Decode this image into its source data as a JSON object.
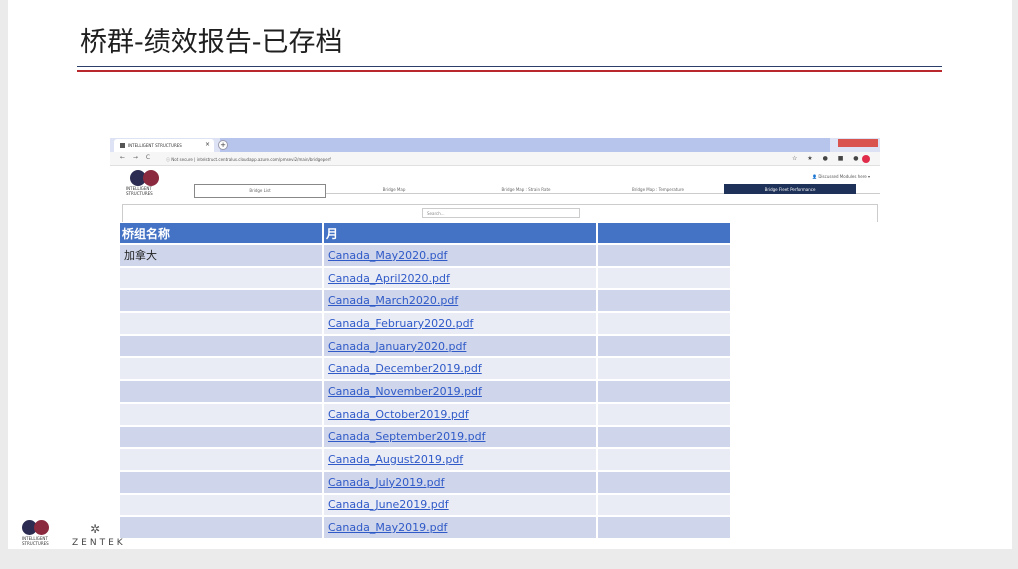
{
  "slide": {
    "title": "桥群-绩效报告-已存档"
  },
  "browser": {
    "tab_title": "INTELLIGENT STRUCTURES",
    "tab_close": "×",
    "new_tab": "+",
    "nav_buttons": "← → C",
    "url": "ⓘ Not secure  |  intelstruct.centralus.cloudapp.azure.com/pmsevi2/main/bridgeperf",
    "ext_icons": "☆ ★ ● ■ ●",
    "logo_text": "INTELLIGENT STRUCTURES",
    "signout": "👤 Discussed Modules here ▾",
    "nav_tabs": [
      "Bridge List",
      "Bridge Map",
      "Bridge Map : Strain Rate",
      "Bridge Map : Temperature",
      "Bridge Fleet Performance"
    ],
    "search_placeholder": "Search..."
  },
  "table": {
    "headers": [
      "桥组名称",
      "月",
      ""
    ],
    "group_name": "加拿大",
    "rows": [
      "Canada_May2020.pdf",
      "Canada_April2020.pdf",
      "Canada_March2020.pdf",
      "Canada_February2020.pdf",
      "Canada_January2020.pdf",
      "Canada_December2019.pdf",
      "Canada_November2019.pdf",
      "Canada_October2019.pdf",
      "Canada_September2019.pdf",
      "Canada_August2019.pdf",
      "Canada_July2019.pdf",
      "Canada_June2019.pdf",
      "Canada_May2019.pdf"
    ]
  },
  "footer": {
    "logo_text": "INTELLIGENT STRUCTURES",
    "zentek": "ZENTEK"
  },
  "colors": {
    "header_blue": "#4472c4",
    "row_dark": "#cfd5ea",
    "row_light": "#e9ebf5",
    "link": "#2f5ac8",
    "rule_navy": "#2c3e6b",
    "rule_red": "#b8282c"
  }
}
